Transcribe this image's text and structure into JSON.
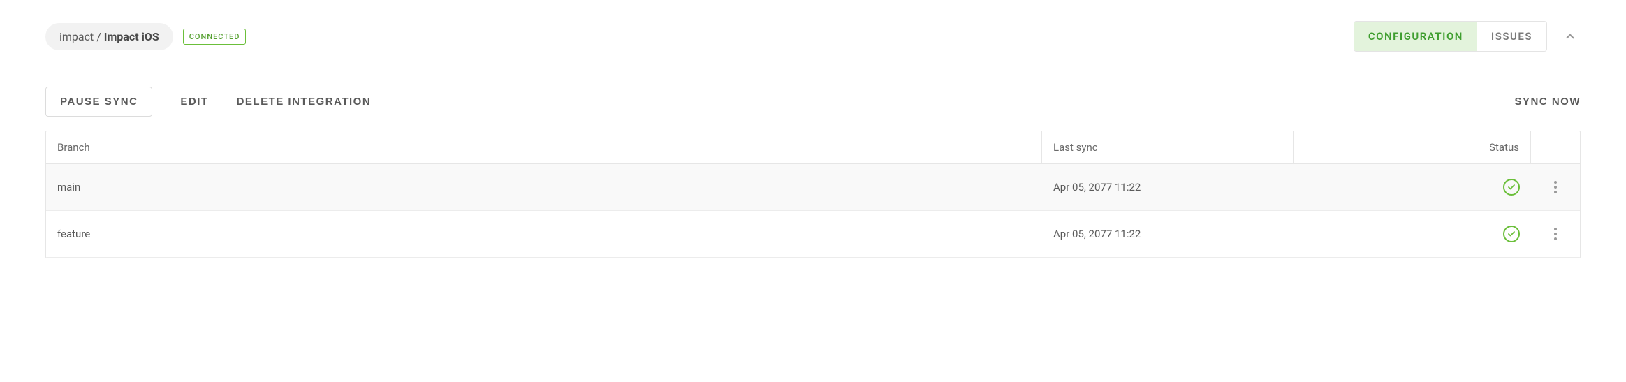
{
  "breadcrumb": {
    "org": "impact",
    "separator": " / ",
    "project": "Impact iOS"
  },
  "status_badge": "CONNECTED",
  "tabs": {
    "configuration": "CONFIGURATION",
    "issues": "ISSUES"
  },
  "actions": {
    "pause_sync": "PAUSE SYNC",
    "edit": "EDIT",
    "delete": "DELETE INTEGRATION",
    "sync_now": "SYNC NOW"
  },
  "table": {
    "headers": {
      "branch": "Branch",
      "last_sync": "Last sync",
      "status": "Status"
    },
    "rows": [
      {
        "branch": "main",
        "last_sync": "Apr 05, 2077 11:22"
      },
      {
        "branch": "feature",
        "last_sync": "Apr 05, 2077 11:22"
      }
    ]
  }
}
